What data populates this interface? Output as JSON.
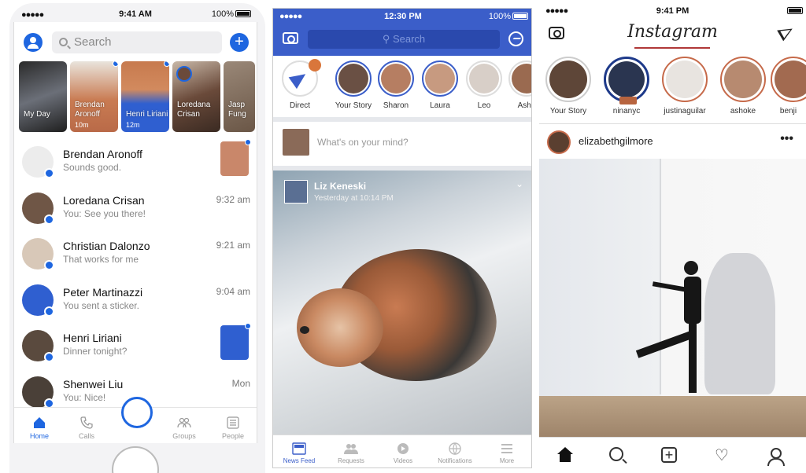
{
  "messenger": {
    "status": {
      "signal": "●●●●●",
      "time": "9:41 AM",
      "battery": "100%"
    },
    "search_placeholder": "Search",
    "stories": [
      {
        "name": "My Day",
        "ago": "",
        "color": "#3a3a3a"
      },
      {
        "name": "Brendan Aronoff",
        "ago": "10m",
        "color": "#c97b52"
      },
      {
        "name": "Henri Liriani",
        "ago": "12m",
        "color": "#2f5fd0"
      },
      {
        "name": "Loredana Crisan",
        "ago": "",
        "color": "#7a5a4a"
      },
      {
        "name": "Jasp Fung",
        "ago": "",
        "color": "#8a7868"
      }
    ],
    "conversations": [
      {
        "name": "Brendan Aronoff",
        "message": "Sounds good.",
        "time": "",
        "thumb_color": "#c9876a"
      },
      {
        "name": "Loredana Crisan",
        "message": "You: See you there!",
        "time": "9:32 am",
        "thumb_color": ""
      },
      {
        "name": "Christian Dalonzo",
        "message": "That works for me",
        "time": "9:21 am",
        "thumb_color": ""
      },
      {
        "name": "Peter Martinazzi",
        "message": "You sent a sticker.",
        "time": "9:04 am",
        "thumb_color": ""
      },
      {
        "name": "Henri Liriani",
        "message": "Dinner tonight?",
        "time": "",
        "thumb_color": "#2f5fd0"
      },
      {
        "name": "Shenwei Liu",
        "message": "You: Nice!",
        "time": "Mon",
        "thumb_color": ""
      }
    ],
    "tabs": {
      "home": "Home",
      "calls": "Calls",
      "groups": "Groups",
      "people": "People"
    },
    "accent": "#1e66e0"
  },
  "facebook": {
    "status": {
      "signal": "●●●●●",
      "time": "12:30 PM",
      "battery": "100%"
    },
    "search_placeholder": "Search",
    "stories": [
      {
        "label": "Direct"
      },
      {
        "label": "Your Story"
      },
      {
        "label": "Sharon"
      },
      {
        "label": "Laura"
      },
      {
        "label": "Leo"
      },
      {
        "label": "Ashe"
      }
    ],
    "compose_placeholder": "What's on your mind?",
    "post": {
      "author": "Liz Keneski",
      "time": "Yesterday at 10:14 PM",
      "chevron": "⌄"
    },
    "tabs": {
      "news_feed": "News Feed",
      "requests": "Requests",
      "videos": "Videos",
      "notifications": "Notifications",
      "more": "More"
    },
    "accent": "#3b5ec9"
  },
  "instagram": {
    "status": {
      "signal": "●●●●●",
      "time": "9:41 PM",
      "battery": ""
    },
    "logo": "Instagram",
    "stories": [
      {
        "label": "Your Story"
      },
      {
        "label": "ninanyc"
      },
      {
        "label": "justinaguilar"
      },
      {
        "label": "ashoke"
      },
      {
        "label": "benji"
      }
    ],
    "post": {
      "username": "elizabethgilmore",
      "more": "•••"
    },
    "heart_glyph": "♡",
    "add_glyph": "+"
  }
}
